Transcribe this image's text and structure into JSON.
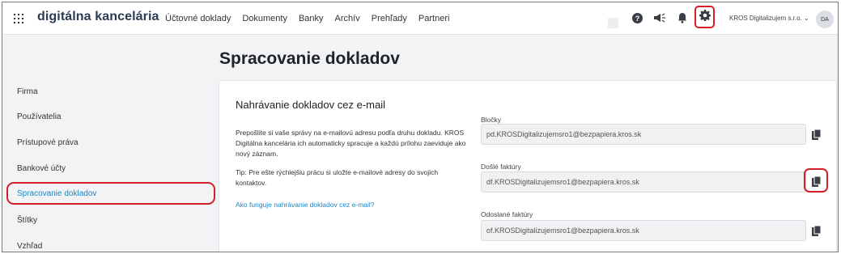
{
  "app": {
    "logo": "digitálna kancelária"
  },
  "nav": {
    "items": [
      "Účtovné doklady",
      "Dokumenty",
      "Banky",
      "Archív",
      "Prehľady",
      "Partneri"
    ]
  },
  "header": {
    "company": "KROS Digitalizujem s.r.o. ⌄",
    "avatar": "DA",
    "icons": [
      "help-icon",
      "megaphone-icon",
      "bell-icon",
      "gear-icon"
    ]
  },
  "page": {
    "title": "Spracovanie dokladov"
  },
  "sidebar": {
    "items": [
      {
        "label": "Firma"
      },
      {
        "label": "Používatelia"
      },
      {
        "label": "Prístupové práva"
      },
      {
        "label": "Bankové účty"
      },
      {
        "label": "Spracovanie dokladov",
        "active": true
      },
      {
        "label": "Štítky"
      },
      {
        "label": "Vzhľad"
      }
    ]
  },
  "card": {
    "title": "Nahrávanie dokladov cez e-mail",
    "description": "Prepošlite si vaše správy na e-mailovú adresu podľa druhu dokladu. KROS Digitálna kancelária ich automaticky spracuje a každú prílohu zaeviduje ako nový záznam.",
    "tip": "Tip: Pre ešte rýchlejšiu prácu si uložte e-mailové adresy do svojich kontaktov.",
    "help_link": "Ako funguje nahrávanie dokladov cez e-mail?",
    "fields": [
      {
        "label": "Bločky",
        "value": "pd.KROSDigitalizujemsro1@bezpapiera.kros.sk"
      },
      {
        "label": "Došlé faktúry",
        "value": "df.KROSDigitalizujemsro1@bezpapiera.kros.sk"
      },
      {
        "label": "Odoslané faktúry",
        "value": "of.KROSDigitalizujemsro1@bezpapiera.kros.sk"
      }
    ]
  },
  "colors": {
    "highlight": "#d31f26",
    "link": "#1a85c5",
    "logo": "#2a3b54"
  }
}
